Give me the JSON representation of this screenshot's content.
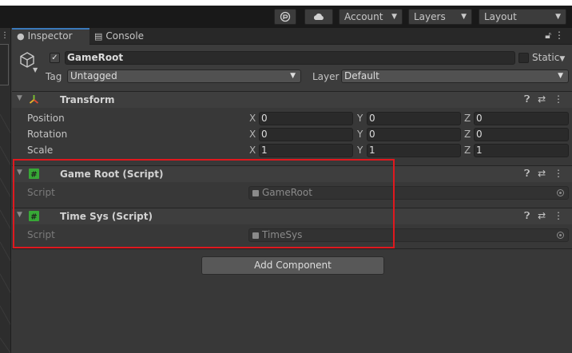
{
  "toolbar": {
    "package_icon": "package-icon",
    "cloud_icon": "cloud-icon",
    "account_label": "Account",
    "layers_label": "Layers",
    "layout_label": "Layout"
  },
  "tabs": [
    {
      "label": "Inspector",
      "icon": "info-icon",
      "active": true
    },
    {
      "label": "Console",
      "icon": "console-icon",
      "active": false
    }
  ],
  "game_object": {
    "active": true,
    "name": "GameRoot",
    "static_label": "Static",
    "tag_label": "Tag",
    "tag_value": "Untagged",
    "layer_label": "Layer",
    "layer_value": "Default"
  },
  "transform": {
    "title": "Transform",
    "rows": [
      {
        "label": "Position",
        "x": "0",
        "y": "0",
        "z": "0"
      },
      {
        "label": "Rotation",
        "x": "0",
        "y": "0",
        "z": "0"
      },
      {
        "label": "Scale",
        "x": "1",
        "y": "1",
        "z": "1"
      }
    ]
  },
  "axes": {
    "x": "X",
    "y": "Y",
    "z": "Z"
  },
  "components": [
    {
      "title": "Game Root (Script)",
      "field_label": "Script",
      "field_value": "GameRoot"
    },
    {
      "title": "Time Sys (Script)",
      "field_label": "Script",
      "field_value": "TimeSys"
    }
  ],
  "add_component_label": "Add Component",
  "colors": {
    "accent": "#3a79bb",
    "highlight": "#e0181e",
    "script_icon": "#37a836"
  }
}
